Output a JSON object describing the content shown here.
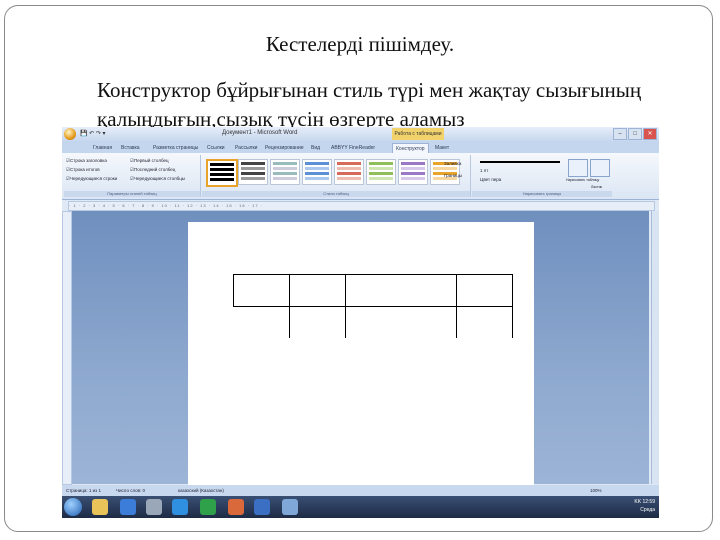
{
  "slide": {
    "title": "Кестелерді пішімдеу.",
    "body": "Конструктор бұйрығынан стиль түрі мен жақтау сызығының қалыңдығын,сызық түсін өзгерте аламыз"
  },
  "word": {
    "window_title": "Документ1 - Microsoft Word",
    "context_title": "Работа с таблицами",
    "tabs": [
      "Главная",
      "Вставка",
      "Разметка страницы",
      "Ссылки",
      "Рассылки",
      "Рецензирование",
      "Вид",
      "ABBYY FineReader",
      "Конструктор",
      "Макет"
    ],
    "active_tab": "Конструктор",
    "groups": {
      "style_options": "Параметры стилей таблиц",
      "table_styles": "Стили таблиц",
      "borders": "Нарисовать границы"
    },
    "style_options": [
      "Строка заголовка",
      "Строка итогов",
      "Чередующиеся строки",
      "Первый столбец",
      "Последний столбец",
      "Чередующиеся столбцы"
    ],
    "shading_label": "Заливка",
    "borders_label": "Границы",
    "pen_weight": "1 пт",
    "pen_color_label": "Цвет пера",
    "draw_table_label": "Нарисовать таблицу",
    "eraser_label": "Ластик",
    "status": {
      "page": "Страница: 1 из 1",
      "words": "Число слов: 0",
      "language": "казахский (Казахстан)",
      "zoom": "100%"
    },
    "tray": {
      "lang": "KK",
      "time": "12:59",
      "date": "Среда"
    }
  },
  "colors": {
    "accent": "#e8a32a",
    "ribbon": "#dbe6f4",
    "doc_bg": "#8ea9cf"
  }
}
